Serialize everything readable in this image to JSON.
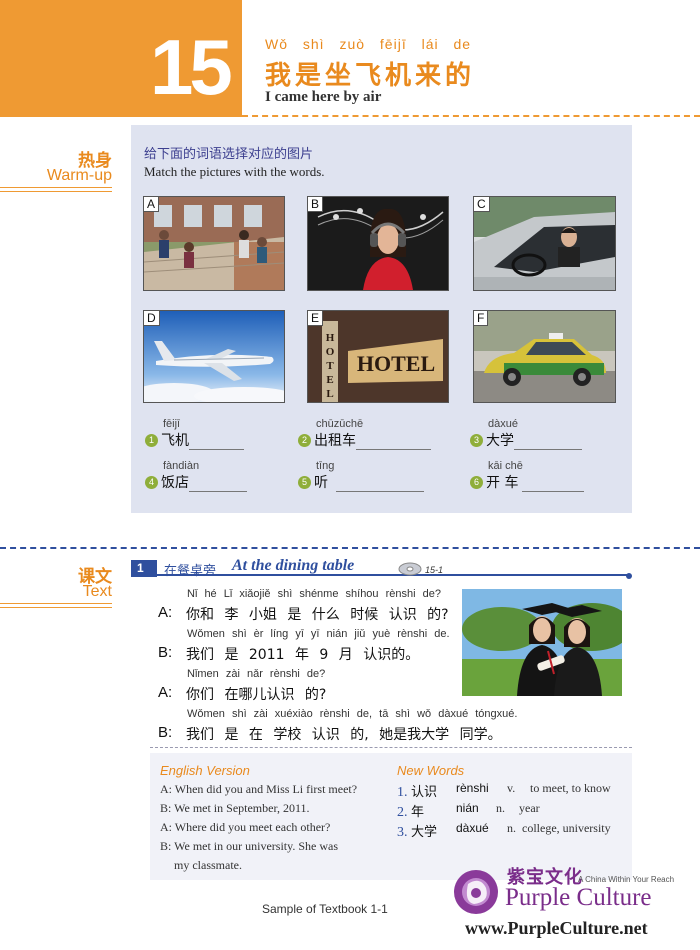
{
  "header": {
    "lesson_number": "15",
    "title_pinyin": "Wǒ shì zuò fēijī lái de",
    "title_cn": "我是坐飞机来的",
    "title_en": "I came here by air"
  },
  "warmup": {
    "label_cn": "热身",
    "label_en": "Warm-up",
    "instruction_cn": "给下面的词语选择对应的图片",
    "instruction_en": "Match the pictures with the words.",
    "pictures": [
      "A",
      "B",
      "C",
      "D",
      "E",
      "F"
    ],
    "hotel_sign": "HOTEL",
    "words": [
      {
        "num": "1",
        "pinyin": "fēijī",
        "cn": "飞机"
      },
      {
        "num": "2",
        "pinyin": "chūzūchē",
        "cn": "出租车"
      },
      {
        "num": "3",
        "pinyin": "dàxué",
        "cn": "大学"
      },
      {
        "num": "4",
        "pinyin": "fàndiàn",
        "cn": "饭店"
      },
      {
        "num": "5",
        "pinyin": "tīng",
        "cn": "听"
      },
      {
        "num": "6",
        "pinyin": "kāi chē",
        "cn": "开 车"
      }
    ]
  },
  "text_section": {
    "label_cn": "课文",
    "label_en": "Text",
    "number": "1",
    "title_cn": "在餐桌旁",
    "title_en": "At the dining table",
    "track": "15-1",
    "dialogue": [
      {
        "speaker": "A:",
        "pinyin": "Nǐ hé  Lǐ  xiǎojiě shì shénme shíhou rènshi de?",
        "cn": "你和 李 小姐 是 什么 时候 认识 的?"
      },
      {
        "speaker": "B:",
        "pinyin": "Wǒmen shì èr líng yī yī nián jiǔ yuè rènshi de.",
        "cn": "我们  是   2011  年 9 月 认识的。"
      },
      {
        "speaker": "A:",
        "pinyin": "Nǐmen zài  nǎr  rènshi de?",
        "cn": "你们 在哪儿认识 的?"
      },
      {
        "speaker": "B:",
        "pinyin": "Wǒmen shì zài xuéxiào rènshi de,    tā shì wǒ dàxué tóngxué.",
        "cn": "我们  是 在 学校 认识 的, 她是我大学 同学。"
      }
    ],
    "english_version_title": "English Version",
    "english_version": [
      "A: When did you and Miss Li first meet?",
      "B: We met in September, 2011.",
      "A: Where did you meet each other?",
      "B: We met in our university. She was",
      "my classmate."
    ],
    "new_words_title": "New Words",
    "new_words": [
      {
        "num": "1.",
        "cn": "认识",
        "pinyin": "rènshi",
        "pos": "v.",
        "meaning": "to meet, to know"
      },
      {
        "num": "2.",
        "cn": "年",
        "pinyin": "nián",
        "pos": "n.",
        "meaning": "year"
      },
      {
        "num": "3.",
        "cn": "大学",
        "pinyin": "dàxué",
        "pos": "n.",
        "meaning": "college, university"
      }
    ]
  },
  "footer": {
    "caption": "Sample of Textbook 1-1",
    "brand_cn": "紫宝文化",
    "brand_tagline": "A China Within Your Reach",
    "brand_name": "Purple Culture",
    "brand_url": "www.PurpleCulture.net"
  }
}
